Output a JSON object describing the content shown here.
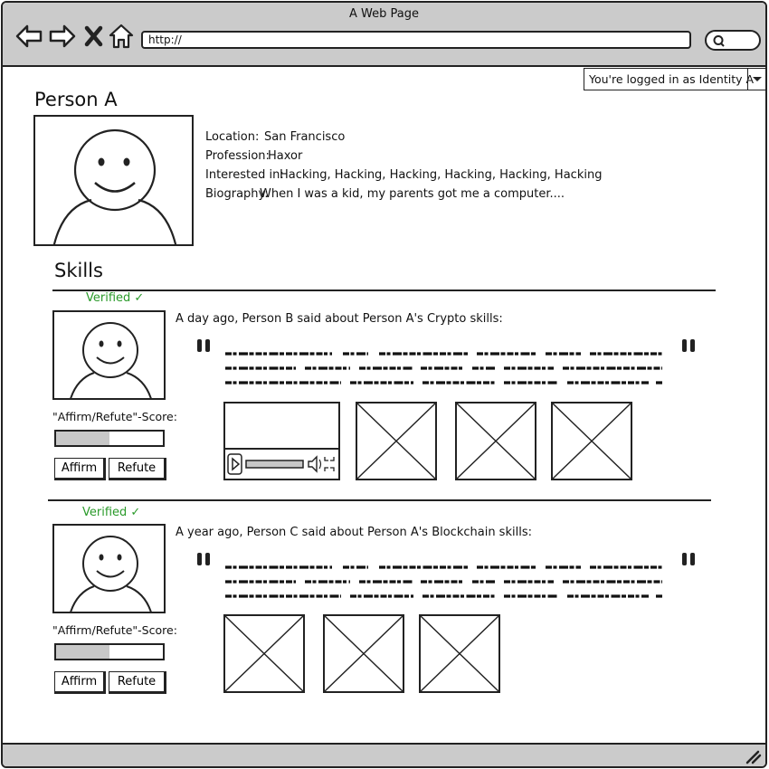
{
  "window": {
    "title": "A Web Page",
    "url": "http://"
  },
  "login": {
    "label": "You're logged in as Identity A"
  },
  "profile": {
    "name": "Person A",
    "fields": [
      {
        "label": "Location:",
        "value": "San Francisco"
      },
      {
        "label": "Profession:",
        "value": "Haxor"
      },
      {
        "label": "Interested in:",
        "value": "Hacking, Hacking, Hacking, Hacking, Hacking, Hacking"
      },
      {
        "label": "Biography:",
        "value": "When I was a kid, my parents got me a computer...."
      }
    ]
  },
  "skills": {
    "heading": "Skills",
    "entries": [
      {
        "verified": "Verified ✓",
        "statement": "A day ago, Person B said about Person A's Crypto skills:",
        "score_label": "\"Affirm/Refute\"-Score:",
        "score_fraction": 0.5,
        "affirm_label": "Affirm",
        "refute_label": "Refute"
      },
      {
        "verified": "Verified ✓",
        "statement": "A year ago, Person C said about Person A's Blockchain skills:",
        "score_label": "\"Affirm/Refute\"-Score:",
        "score_fraction": 0.5,
        "affirm_label": "Affirm",
        "refute_label": "Refute"
      }
    ]
  },
  "colors": {
    "chrome": "#cbcbcb",
    "verified": "#2a9a2a",
    "score_fill": "#c8c8c8"
  }
}
